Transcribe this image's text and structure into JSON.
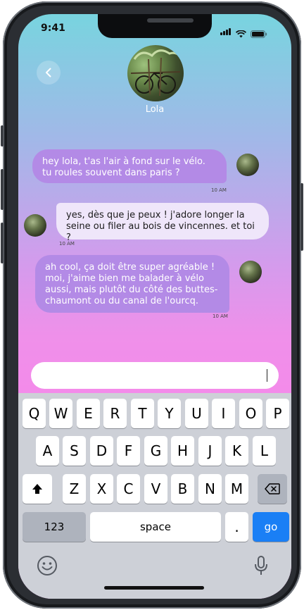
{
  "status_bar": {
    "time": "9:41"
  },
  "header": {
    "back_icon": "chevron-left-icon",
    "contact_name": "Lola"
  },
  "messages": [
    {
      "direction": "outgoing",
      "text": "hey lola, t'as l'air à fond sur le vélo. tu roules souvent dans paris ?",
      "time": "10 AM"
    },
    {
      "direction": "incoming",
      "text": "yes, dès que je peux ! j'adore longer la seine ou filer au bois de vincennes. et toi ?",
      "time": "10 AM"
    },
    {
      "direction": "outgoing",
      "text": "ah cool, ça doit être super agréable ! moi, j'aime bien me balader à vélo aussi, mais plutôt du côté des buttes-chaumont ou du canal de l'ourcq.",
      "time": "10 AM"
    }
  ],
  "input": {
    "value": ""
  },
  "keyboard": {
    "row1": [
      "Q",
      "W",
      "E",
      "R",
      "T",
      "Y",
      "U",
      "I",
      "O",
      "P"
    ],
    "row2": [
      "A",
      "S",
      "D",
      "F",
      "G",
      "H",
      "J",
      "K",
      "L"
    ],
    "row3": [
      "Z",
      "X",
      "C",
      "V",
      "B",
      "N",
      "M"
    ],
    "numbers_label": "123",
    "space_label": "space",
    "period_label": ".",
    "go_label": "go"
  },
  "colors": {
    "accent": "#1a7ff5",
    "outgoing_bubble": "#b38ae6",
    "incoming_bubble": "#efe6fa"
  }
}
